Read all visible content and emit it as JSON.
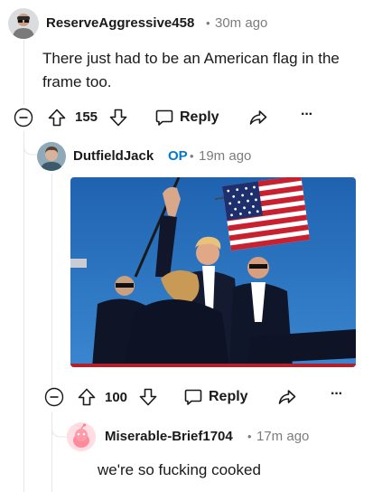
{
  "comments": [
    {
      "username": "ReserveAggressive458",
      "separator": "•",
      "time": "30m ago",
      "body_line1": "There just had to be an American flag in the",
      "body_line2": "frame too.",
      "vote_count": "155",
      "reply_label": "Reply",
      "more_label": "···"
    },
    {
      "username": "DutfieldJack",
      "op_badge": "OP",
      "separator": "•",
      "time": "19m ago",
      "vote_count": "100",
      "reply_label": "Reply",
      "more_label": "···"
    },
    {
      "username": "Miserable-Brief1704",
      "separator": "•",
      "time": "17m ago",
      "body": "we're so fucking cooked"
    }
  ],
  "colors": {
    "sky": "#2a6fb8",
    "thread_line": "#e5e8ea",
    "op_blue": "#0079d3",
    "snoo_pink": "#ff8a9a"
  }
}
